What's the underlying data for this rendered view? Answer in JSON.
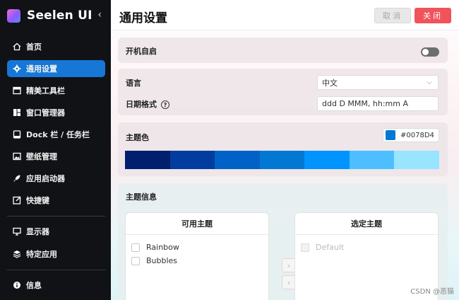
{
  "sidebar": {
    "brand": "Seelen UI",
    "collapse_icon": "‹",
    "items": [
      {
        "label": "首页",
        "icon": "home-icon"
      },
      {
        "label": "通用设置",
        "icon": "gear-icon",
        "active": true
      },
      {
        "label": "精美工具栏",
        "icon": "toolbar-icon"
      },
      {
        "label": "窗口管理器",
        "icon": "window-manager-icon"
      },
      {
        "label": "Dock 栏 / 任务栏",
        "icon": "dock-icon"
      },
      {
        "label": "壁纸管理",
        "icon": "wallpaper-icon"
      },
      {
        "label": "应用启动器",
        "icon": "rocket-icon"
      },
      {
        "label": "快捷键",
        "icon": "shortcut-icon"
      },
      {
        "label": "显示器",
        "icon": "monitor-icon"
      },
      {
        "label": "特定应用",
        "icon": "layers-icon"
      },
      {
        "label": "信息",
        "icon": "info-icon"
      }
    ]
  },
  "header": {
    "title": "通用设置",
    "cancel_label": "取消",
    "close_label": "关闭"
  },
  "settings": {
    "autostart_label": "开机自启",
    "autostart_enabled": false,
    "language_label": "语言",
    "language_value": "中文",
    "date_format_label": "日期格式",
    "date_format_value": "ddd D MMM, hh:mm A",
    "theme_color_label": "主题色",
    "theme_color_value": "#0078D4",
    "palette": [
      "#001f6e",
      "#003d9e",
      "#0061c6",
      "#0078d4",
      "#0094ff",
      "#4dbfff",
      "#99e4ff"
    ]
  },
  "themes": {
    "section_label": "主题信息",
    "available_title": "可用主题",
    "available": [
      "Rainbow",
      "Bubbles"
    ],
    "selected_title": "选定主题",
    "selected": [
      "Default"
    ],
    "move_right_icon": "chevron-right-icon",
    "move_left_icon": "chevron-left-icon"
  },
  "watermark": "CSDN @恶猫"
}
